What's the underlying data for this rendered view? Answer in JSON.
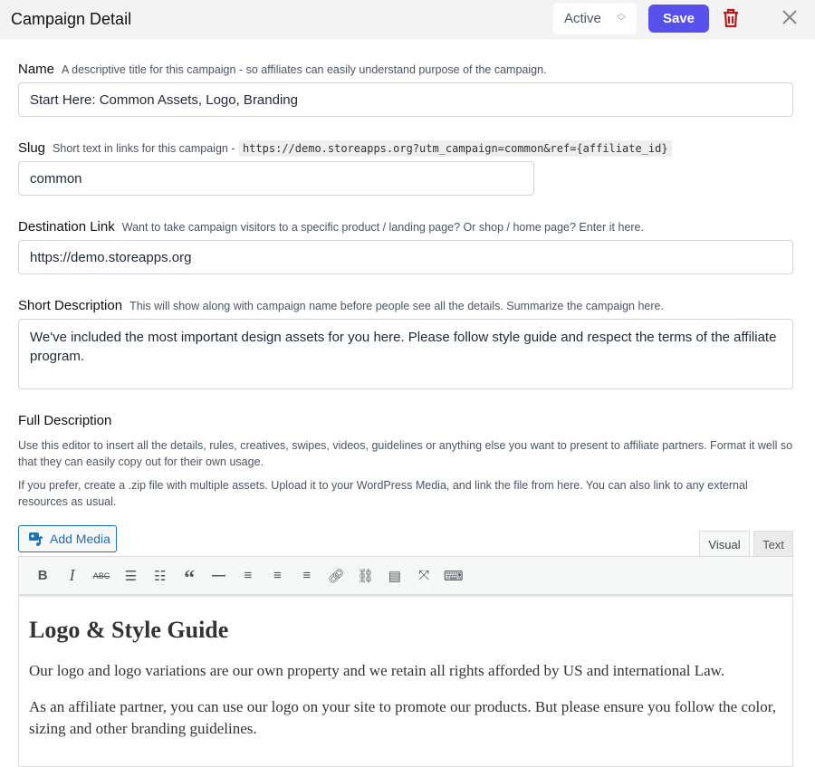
{
  "header": {
    "title": "Campaign Detail",
    "status": "Active",
    "save_label": "Save"
  },
  "name": {
    "label": "Name",
    "hint": "A descriptive title for this campaign - so affiliates can easily understand purpose of the campaign.",
    "value": "Start Here: Common Assets, Logo, Branding"
  },
  "slug": {
    "label": "Slug",
    "hint": "Short text in links for this campaign -",
    "url": "https://demo.storeapps.org?utm_campaign=common&ref={affiliate_id}",
    "value": "common"
  },
  "destination": {
    "label": "Destination Link",
    "hint": "Want to take campaign visitors to a specific product / landing page? Or shop / home page? Enter it here.",
    "value": "https://demo.storeapps.org"
  },
  "short_desc": {
    "label": "Short Description",
    "hint": "This will show along with campaign name before people see all the details. Summarize the campaign here.",
    "value": "We've included the most important design assets for you here. Please follow style guide and respect the terms of the affiliate program."
  },
  "full_desc": {
    "label": "Full Description",
    "help1": "Use this editor to insert all the details, rules, creatives, swipes, videos, guidelines or anything else you want to present to affiliate partners. Format it well so that they can easily copy out for their own usage.",
    "help2": "If you prefer, create a .zip file with multiple assets. Upload it to your WordPress Media, and link the file from here. You can also link to any external resources as usual."
  },
  "editor": {
    "add_media": "Add Media",
    "tabs": [
      "Visual",
      "Text"
    ],
    "active_tab": "Visual",
    "toolbar": [
      "bold",
      "italic",
      "strikethrough",
      "bullet-list",
      "numbered-list",
      "blockquote",
      "horizontal-rule",
      "align-left",
      "align-center",
      "align-right",
      "link",
      "unlink",
      "read-more",
      "fullscreen",
      "toolbar-toggle"
    ],
    "heading": "Logo & Style Guide",
    "p1": "Our logo and logo variations are our own property and we retain all rights afforded by US and international Law.",
    "p2": "As an affiliate partner, you can use our logo on your site to promote our products. But please ensure you follow the color, sizing and other branding guidelines."
  },
  "colors": {
    "accent": "#5850ec",
    "delete": "#b91c1c",
    "wp_blue": "#2271b1"
  }
}
